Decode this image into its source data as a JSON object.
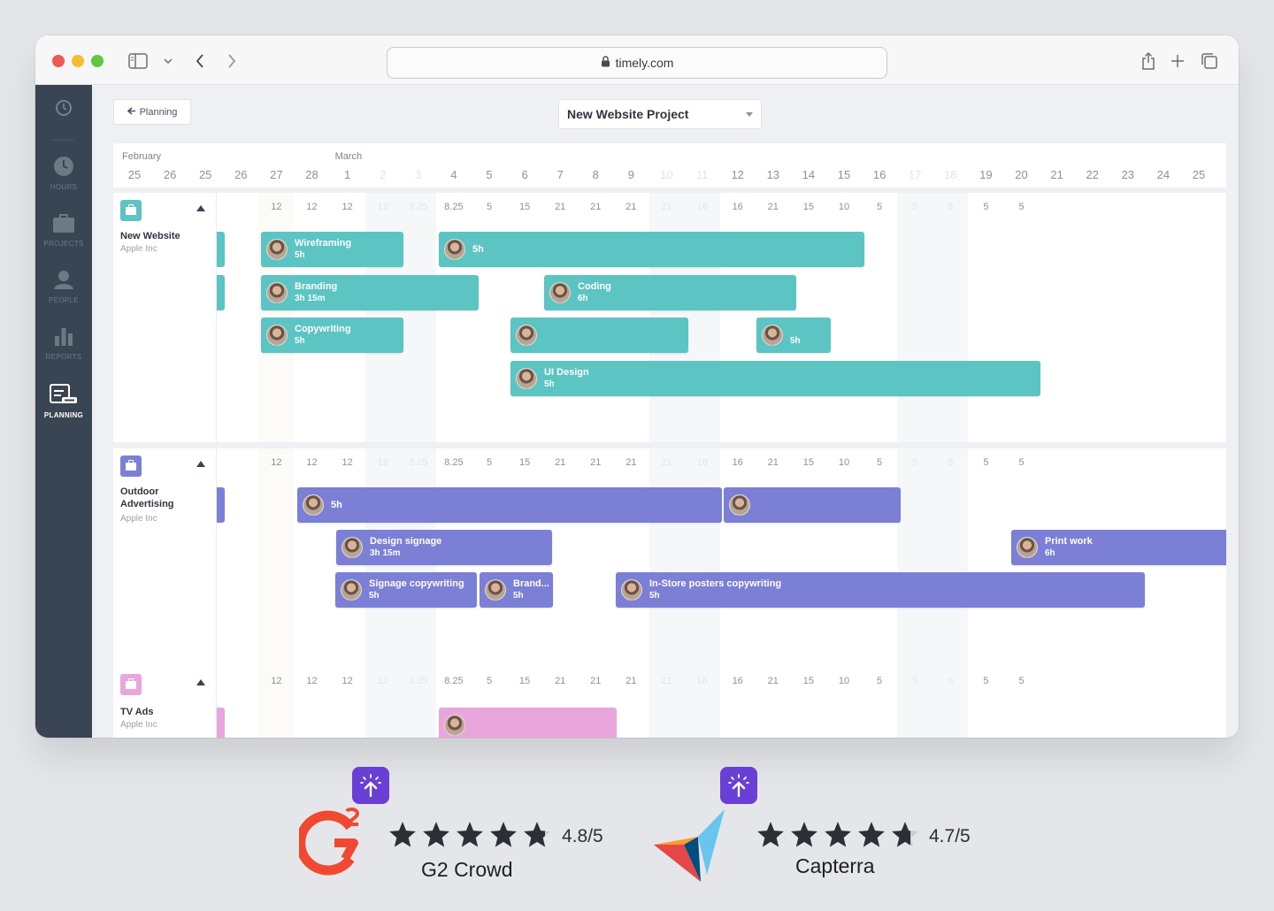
{
  "browser": {
    "url": "timely.com"
  },
  "sidebar": {
    "items": [
      {
        "label": "",
        "icon": "clock-icon"
      },
      {
        "label": "HOURS",
        "icon": "hours-icon"
      },
      {
        "label": "PROJECTS",
        "icon": "briefcase-icon"
      },
      {
        "label": "PEOPLE",
        "icon": "person-icon"
      },
      {
        "label": "REPORTS",
        "icon": "bar-chart-icon"
      },
      {
        "label": "PLANNING",
        "icon": "planning-icon",
        "active": true
      }
    ]
  },
  "header": {
    "back_label": "Planning",
    "project_select": "New Website Project"
  },
  "timeline": {
    "months": [
      {
        "label": "February"
      },
      {
        "label": "March"
      }
    ],
    "days": [
      "25",
      "26",
      "25",
      "26",
      "27",
      "28",
      "1",
      "2",
      "3",
      "4",
      "5",
      "6",
      "7",
      "8",
      "9",
      "10",
      "11",
      "12",
      "13",
      "14",
      "15",
      "16",
      "17",
      "18",
      "19",
      "20",
      "21",
      "22",
      "23",
      "24",
      "25"
    ],
    "hours": [
      "12",
      "12",
      "12",
      "12",
      "3.25",
      "8.25",
      "5",
      "15",
      "21",
      "21",
      "21",
      "21",
      "16",
      "16",
      "21",
      "15",
      "10",
      "5",
      "5",
      "5",
      "5",
      "5"
    ]
  },
  "projects": [
    {
      "name": "New Website",
      "client": "Apple Inc",
      "color": "#5cc5c3",
      "tasks": [
        {
          "title": "Wireframing",
          "hours": "5h"
        },
        {
          "title": "",
          "hours": "5h"
        },
        {
          "title": "Branding",
          "hours": "3h 15m"
        },
        {
          "title": "Coding",
          "hours": "6h"
        },
        {
          "title": "Copywriting",
          "hours": "5h"
        },
        {
          "title": "",
          "hours": ""
        },
        {
          "title": "",
          "hours": "5h"
        },
        {
          "title": "UI Design",
          "hours": "5h"
        }
      ]
    },
    {
      "name": "Outdoor Advertising",
      "client": "Apple Inc",
      "color": "#7b7fd6",
      "tasks": [
        {
          "title": "",
          "hours": "5h"
        },
        {
          "title": "",
          "hours": ""
        },
        {
          "title": "Design signage",
          "hours": "3h 15m"
        },
        {
          "title": "Print work",
          "hours": "6h"
        },
        {
          "title": "Signage copywriting",
          "hours": "5h"
        },
        {
          "title": "Brand...",
          "hours": "5h"
        },
        {
          "title": "In-Store posters copywriting",
          "hours": "5h"
        }
      ]
    },
    {
      "name": "TV Ads",
      "client": "Apple Inc",
      "color": "#e9a6dd",
      "tasks": [
        {
          "title": "",
          "hours": ""
        }
      ]
    }
  ],
  "ratings": [
    {
      "name": "G2 Crowd",
      "score": "4.8/5",
      "stars": 4.8,
      "logo": "g2-logo",
      "badge": "upload-badge-icon"
    },
    {
      "name": "Capterra",
      "score": "4.7/5",
      "stars": 4.7,
      "logo": "capterra-logo",
      "badge": "upload-badge-icon"
    }
  ]
}
